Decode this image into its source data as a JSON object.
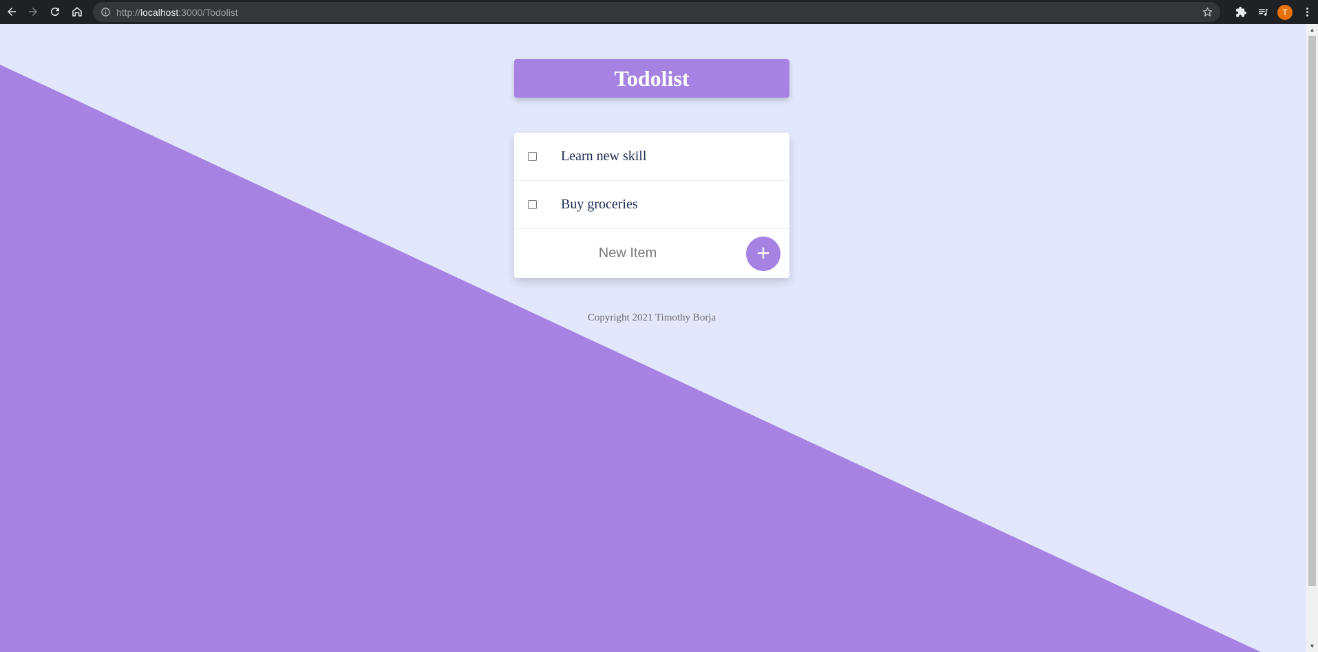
{
  "browser": {
    "url_prefix": "http://",
    "url_host": "localhost",
    "url_rest": ":3000/Todolist",
    "avatar_letter": "T"
  },
  "colors": {
    "accent": "#a683e3",
    "background": "#e3e7fb",
    "card": "#ffffff",
    "item_text": "#1d2a52"
  },
  "header": {
    "title": "Todolist"
  },
  "todo": {
    "items": [
      {
        "label": "Learn new skill",
        "checked": false
      },
      {
        "label": "Buy groceries",
        "checked": false
      }
    ],
    "new_item_placeholder": "New Item",
    "add_label": "+"
  },
  "footer": {
    "text": "Copyright 2021 Timothy Borja"
  }
}
